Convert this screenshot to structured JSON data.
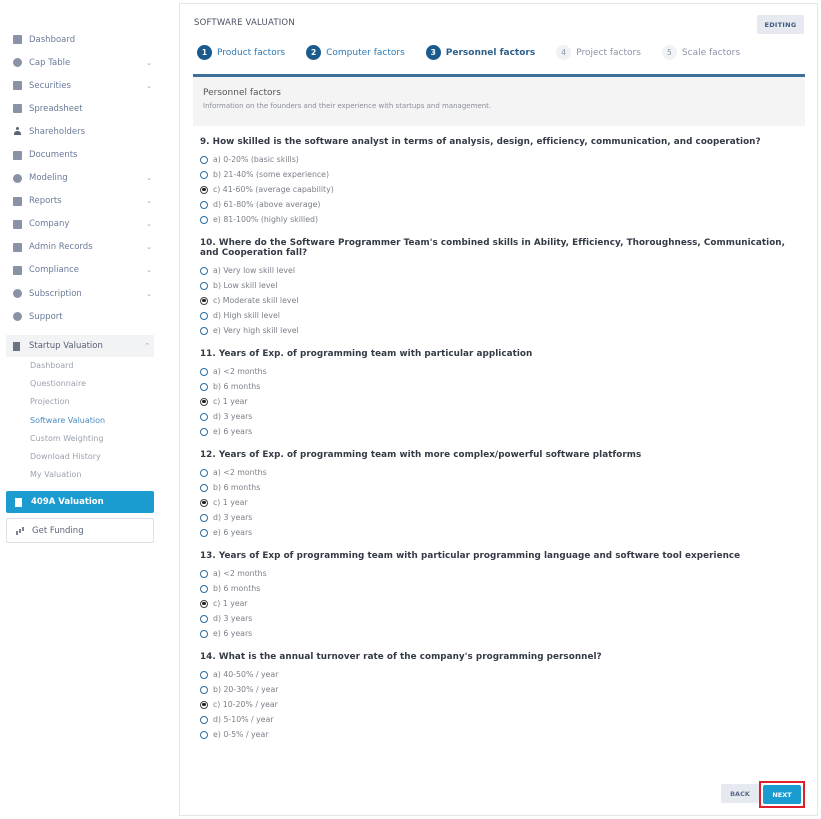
{
  "sidebar": {
    "items": [
      {
        "label": "Dashboard",
        "icon": "dashboard-icon",
        "has_chevron": false
      },
      {
        "label": "Cap Table",
        "icon": "pie-chart-icon",
        "has_chevron": true
      },
      {
        "label": "Securities",
        "icon": "clipboard-icon",
        "has_chevron": true
      },
      {
        "label": "Spreadsheet",
        "icon": "spreadsheet-icon",
        "has_chevron": false
      },
      {
        "label": "Shareholders",
        "icon": "person-icon",
        "has_chevron": false
      },
      {
        "label": "Documents",
        "icon": "folder-icon",
        "has_chevron": false
      },
      {
        "label": "Modeling",
        "icon": "lightbulb-icon",
        "has_chevron": true
      },
      {
        "label": "Reports",
        "icon": "report-icon",
        "has_chevron": true
      },
      {
        "label": "Company",
        "icon": "building-icon",
        "has_chevron": true
      },
      {
        "label": "Admin Records",
        "icon": "records-icon",
        "has_chevron": true
      },
      {
        "label": "Compliance",
        "icon": "shield-icon",
        "has_chevron": true
      },
      {
        "label": "Subscription",
        "icon": "dollar-icon",
        "has_chevron": true
      },
      {
        "label": "Support",
        "icon": "support-icon",
        "has_chevron": false
      }
    ],
    "chevron_down": "⌄",
    "chevron_up": "⌃",
    "group": {
      "label": "Startup Valuation",
      "subitems": [
        {
          "label": "Dashboard",
          "active": false
        },
        {
          "label": "Questionnaire",
          "active": false
        },
        {
          "label": "Projection",
          "active": false
        },
        {
          "label": "Software Valuation",
          "active": true
        },
        {
          "label": "Custom Weighting",
          "active": false
        },
        {
          "label": "Download History",
          "active": false
        },
        {
          "label": "My Valuation",
          "active": false
        }
      ]
    },
    "valuation_409a_label": "409A Valuation",
    "get_funding_label": "Get Funding"
  },
  "main": {
    "title": "SOFTWARE VALUATION",
    "status_badge": "EDITING",
    "steps": [
      {
        "num": "1",
        "label": "Product factors",
        "state": "done"
      },
      {
        "num": "2",
        "label": "Computer factors",
        "state": "done"
      },
      {
        "num": "3",
        "label": "Personnel factors",
        "state": "active"
      },
      {
        "num": "4",
        "label": "Project factors",
        "state": "todo"
      },
      {
        "num": "5",
        "label": "Scale factors",
        "state": "todo"
      }
    ],
    "section": {
      "title": "Personnel factors",
      "description": "Information on the founders and their experience with startups and management."
    },
    "questions": [
      {
        "title": "9. How skilled is the software analyst in terms of analysis, design, efficiency, communication, and cooperation?",
        "options": [
          "a) 0-20% (basic skills)",
          "b) 21-40% (some experience)",
          "c) 41-60% (average capability)",
          "d) 61-80% (above average)",
          "e) 81-100% (highly skilled)"
        ],
        "selected": 2
      },
      {
        "title": "10. Where do the Software Programmer Team's combined skills in Ability, Efficiency, Thoroughness, Communication, and Cooperation fall?",
        "options": [
          "a) Very low skill level",
          "b) Low skill level",
          "c) Moderate skill level",
          "d) High skill level",
          "e) Very high skill level"
        ],
        "selected": 2
      },
      {
        "title": "11. Years of Exp. of programming team with particular application",
        "options": [
          "a) <2 months",
          "b) 6 months",
          "c) 1 year",
          "d) 3 years",
          "e) 6 years"
        ],
        "selected": 2
      },
      {
        "title": "12. Years of Exp. of programming team with more complex/powerful software platforms",
        "options": [
          "a) <2 months",
          "b) 6 months",
          "c) 1 year",
          "d) 3 years",
          "e) 6 years"
        ],
        "selected": 2
      },
      {
        "title": "13. Years of Exp of programming team with particular programming language and software tool experience",
        "options": [
          "a) <2 months",
          "b) 6 months",
          "c) 1 year",
          "d) 3 years",
          "e) 6 years"
        ],
        "selected": 2
      },
      {
        "title": "14. What is the annual turnover rate of the company's programming personnel?",
        "options": [
          "a) 40-50% / year",
          "b) 20-30% / year",
          "c) 10-20% / year",
          "d) 5-10% / year",
          "e) 0-5% / year"
        ],
        "selected": 2
      }
    ],
    "back_label": "BACK",
    "next_label": "NEXT"
  }
}
